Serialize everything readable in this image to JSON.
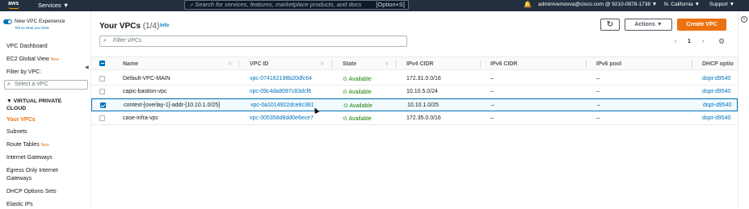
{
  "topbar": {
    "logo": "aws",
    "services_label": "Services ▼",
    "search_placeholder": "Search for services, features, marketplace products, and docs",
    "search_shortcut": "[Option+S]",
    "account": "admin/vemovva@cisco.com @ 9210-0878-1738 ▼",
    "region": "N. California ▼",
    "support": "Support ▼"
  },
  "sidebar": {
    "new_experience": "New VPC Experience",
    "tell_us": "Tell us what you think",
    "vpc_dashboard": "VPC Dashboard",
    "ec2_global_view": "EC2 Global View",
    "new_badge": "New",
    "filter_label": "Filter by VPC:",
    "filter_placeholder": "Select a VPC",
    "section_vpc": "▼ VIRTUAL PRIVATE",
    "section_vpc2": "CLOUD",
    "your_vpcs": "Your VPCs",
    "subnets": "Subnets",
    "route_tables": "Route Tables",
    "internet_gateways": "Internet Gateways",
    "egress_only": "Egress Only Internet",
    "egress_only2": "Gateways",
    "dhcp_option_sets": "DHCP Options Sets",
    "elastic_ips": "Elastic IPs"
  },
  "main": {
    "title": "Your VPCs",
    "count": "(1/4)",
    "info": "Info",
    "refresh_icon": "↻",
    "actions_label": "Actions ▼",
    "create_label": "Create VPC",
    "filter_placeholder": "Filter VPCs",
    "page_number": "1",
    "columns": [
      "Name",
      "VPC ID",
      "State",
      "IPv4 CIDR",
      "IPv6 CIDR",
      "IPv6 pool",
      "DHCP optio"
    ],
    "rows": [
      {
        "name": "Default-VPC-MAIN",
        "vpc_id": "vpc-074162198b20dfc64",
        "state": "Available",
        "ipv4": "172.31.0.0/16",
        "ipv6": "–",
        "pool": "–",
        "dhcp": "dopt-d9540",
        "selected": false
      },
      {
        "name": "capic-bastion-vpc",
        "vpc_id": "vpc-09c4da8097c83dcf6",
        "state": "Available",
        "ipv4": "10.10.5.0/24",
        "ipv6": "–",
        "pool": "–",
        "dhcp": "dopt-d9540",
        "selected": false
      },
      {
        "name": "context-[overlay-1]-addr-[10.10.1.0/25]",
        "vpc_id": "vpc-0a1014922dce8c381",
        "state": "Available",
        "ipv4": "10.10.1.0/25",
        "ipv6": "–",
        "pool": "–",
        "dhcp": "dopt-d9540",
        "selected": true
      },
      {
        "name": "case-infra-vpc",
        "vpc_id": "vpc-005358d8dd0e6ece7",
        "state": "Available",
        "ipv4": "172.35.0.0/16",
        "ipv6": "–",
        "pool": "–",
        "dhcp": "dopt-d9540",
        "selected": false
      }
    ]
  },
  "colors": {
    "accent": "#ec7211",
    "link": "#0073bb",
    "ok": "#1d8102",
    "topbar": "#232f3e"
  }
}
